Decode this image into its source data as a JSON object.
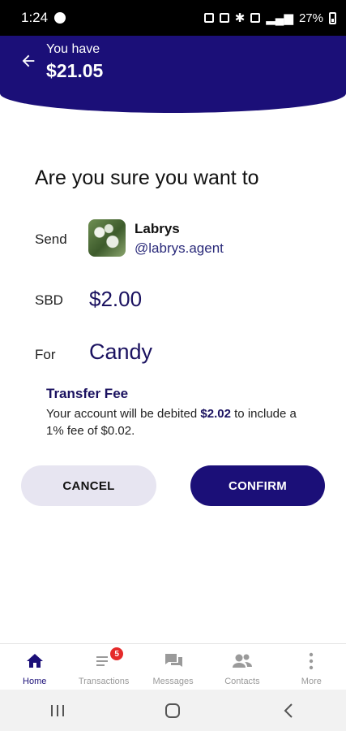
{
  "status_bar": {
    "time": "1:24",
    "battery": "27%"
  },
  "header": {
    "balance_label": "You have",
    "balance_value": "$21.05"
  },
  "confirm": {
    "title": "Are you sure you want to",
    "send_label": "Send",
    "recipient_name": "Labrys",
    "recipient_handle": "@labrys.agent",
    "currency_label": "SBD",
    "amount": "$2.00",
    "for_label": "For",
    "purpose": "Candy"
  },
  "fee": {
    "title": "Transfer Fee",
    "text_before": "Your account will be debited ",
    "debit_amount": "$2.02",
    "text_after": " to include a 1% fee of $0.02."
  },
  "buttons": {
    "cancel": "CANCEL",
    "confirm": "CONFIRM"
  },
  "bottom_nav": {
    "items": [
      {
        "label": "Home",
        "icon": "home-icon",
        "active": true
      },
      {
        "label": "Transactions",
        "icon": "list-icon",
        "badge": "5"
      },
      {
        "label": "Messages",
        "icon": "chat-icon"
      },
      {
        "label": "Contacts",
        "icon": "contacts-icon"
      },
      {
        "label": "More",
        "icon": "more-vert-icon"
      }
    ]
  },
  "colors": {
    "primary": "#1b0f78",
    "badge": "#e52a2a",
    "cancel_bg": "#e7e5f1"
  }
}
